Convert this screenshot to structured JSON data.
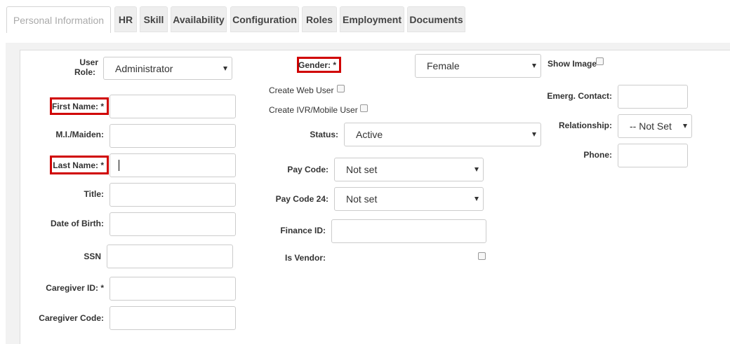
{
  "tabs": [
    {
      "label": "Personal Information",
      "active": true
    },
    {
      "label": "HR"
    },
    {
      "label": "Skill"
    },
    {
      "label": "Availability"
    },
    {
      "label": "Configuration"
    },
    {
      "label": "Roles"
    },
    {
      "label": "Employment"
    },
    {
      "label": "Documents"
    }
  ],
  "form": {
    "user_role_label_line1": "User",
    "user_role_label_line2": "Role:",
    "user_role_value": "Administrator",
    "first_name_label": "First Name: *",
    "mi_label": "M.I./Maiden:",
    "last_name_label": "Last Name: *",
    "title_label": "Title:",
    "dob_label": "Date of Birth:",
    "ssn_label": "SSN",
    "caregiver_id_label": "Caregiver ID: *",
    "caregiver_code_label": "Caregiver Code:",
    "gender_label": "Gender: *",
    "gender_value": "Female",
    "create_web_user_label": "Create Web User",
    "create_ivr_label": "Create IVR/Mobile User",
    "status_label": "Status:",
    "status_value": "Active",
    "pay_code_label": "Pay Code:",
    "pay_code_value": "Not set",
    "pay_code_24_label": "Pay Code 24:",
    "pay_code_24_value": "Not set",
    "finance_id_label": "Finance ID:",
    "is_vendor_label": "Is Vendor:",
    "show_image_label": "Show Image",
    "emerg_contact_label": "Emerg. Contact:",
    "relationship_label": "Relationship:",
    "relationship_value": "-- Not Set --",
    "phone_label": "Phone:"
  },
  "colors": {
    "required_highlight": "#d00000",
    "tab_background": "#eeeeee",
    "panel_background": "#f2f2f2"
  }
}
